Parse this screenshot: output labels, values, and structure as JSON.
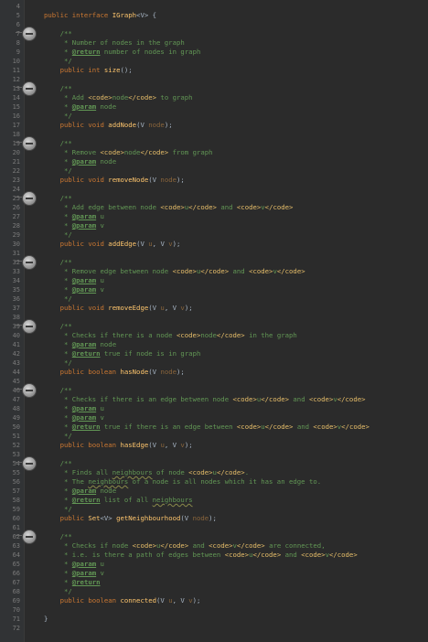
{
  "editor": {
    "lines": [
      {
        "n": "4",
        "segs": []
      },
      {
        "n": "5",
        "segs": [
          [
            "kw",
            "public interface "
          ],
          [
            "cls",
            "IGraph"
          ],
          [
            "",
            "<V> {"
          ]
        ]
      },
      {
        "n": "6",
        "segs": []
      },
      {
        "n": "7",
        "segs": [
          [
            "cm",
            "    /**"
          ]
        ]
      },
      {
        "n": "8",
        "segs": [
          [
            "cm",
            "     * Number of nodes in the graph"
          ]
        ]
      },
      {
        "n": "9",
        "segs": [
          [
            "cm",
            "     * "
          ],
          [
            "ann",
            "@return"
          ],
          [
            "cm",
            " number of nodes in graph"
          ]
        ]
      },
      {
        "n": "10",
        "segs": [
          [
            "cm",
            "     */"
          ]
        ]
      },
      {
        "n": "11",
        "segs": [
          [
            "kw",
            "    public int "
          ],
          [
            "mn",
            "size"
          ],
          [
            "",
            "();"
          ]
        ]
      },
      {
        "n": "12",
        "segs": []
      },
      {
        "n": "13",
        "segs": [
          [
            "cm",
            "    /**"
          ]
        ]
      },
      {
        "n": "14",
        "segs": [
          [
            "cm",
            "     * Add "
          ],
          [
            "tg",
            "<code>"
          ],
          [
            "cm",
            "node"
          ],
          [
            "tg",
            "</code>"
          ],
          [
            "cm",
            " to graph"
          ]
        ]
      },
      {
        "n": "15",
        "segs": [
          [
            "cm",
            "     * "
          ],
          [
            "ann",
            "@param"
          ],
          [
            "cm",
            " node"
          ]
        ]
      },
      {
        "n": "16",
        "segs": [
          [
            "cm",
            "     */"
          ]
        ]
      },
      {
        "n": "17",
        "segs": [
          [
            "kw",
            "    public void "
          ],
          [
            "mn",
            "addNode"
          ],
          [
            "",
            "(V "
          ],
          [
            "pn",
            "node"
          ],
          [
            "",
            ");"
          ]
        ]
      },
      {
        "n": "18",
        "segs": []
      },
      {
        "n": "19",
        "segs": [
          [
            "cm",
            "    /**"
          ]
        ]
      },
      {
        "n": "20",
        "segs": [
          [
            "cm",
            "     * Remove "
          ],
          [
            "tg",
            "<code>"
          ],
          [
            "cm",
            "node"
          ],
          [
            "tg",
            "</code>"
          ],
          [
            "cm",
            " from graph"
          ]
        ]
      },
      {
        "n": "21",
        "segs": [
          [
            "cm",
            "     * "
          ],
          [
            "ann",
            "@param"
          ],
          [
            "cm",
            " node"
          ]
        ]
      },
      {
        "n": "22",
        "segs": [
          [
            "cm",
            "     */"
          ]
        ]
      },
      {
        "n": "23",
        "segs": [
          [
            "kw",
            "    public void "
          ],
          [
            "mn",
            "removeNode"
          ],
          [
            "",
            "(V "
          ],
          [
            "pn",
            "node"
          ],
          [
            "",
            ");"
          ]
        ]
      },
      {
        "n": "24",
        "segs": []
      },
      {
        "n": "25",
        "segs": [
          [
            "cm",
            "    /**"
          ]
        ]
      },
      {
        "n": "26",
        "segs": [
          [
            "cm",
            "     * Add edge between node "
          ],
          [
            "tg",
            "<code>"
          ],
          [
            "cm",
            "u"
          ],
          [
            "tg",
            "</code>"
          ],
          [
            "cm",
            " and "
          ],
          [
            "tg",
            "<code>"
          ],
          [
            "cm",
            "v"
          ],
          [
            "tg",
            "</code>"
          ]
        ]
      },
      {
        "n": "27",
        "segs": [
          [
            "cm",
            "     * "
          ],
          [
            "ann",
            "@param"
          ],
          [
            "cm",
            " u"
          ]
        ]
      },
      {
        "n": "28",
        "segs": [
          [
            "cm",
            "     * "
          ],
          [
            "ann",
            "@param"
          ],
          [
            "cm",
            " v"
          ]
        ]
      },
      {
        "n": "29",
        "segs": [
          [
            "cm",
            "     */"
          ]
        ]
      },
      {
        "n": "30",
        "segs": [
          [
            "kw",
            "    public void "
          ],
          [
            "mn",
            "addEdge"
          ],
          [
            "",
            "(V "
          ],
          [
            "pn",
            "u"
          ],
          [
            "",
            ", V "
          ],
          [
            "pn",
            "v"
          ],
          [
            "",
            ");"
          ]
        ]
      },
      {
        "n": "31",
        "segs": []
      },
      {
        "n": "32",
        "segs": [
          [
            "cm",
            "    /**"
          ]
        ]
      },
      {
        "n": "33",
        "segs": [
          [
            "cm",
            "     * Remove edge between node "
          ],
          [
            "tg",
            "<code>"
          ],
          [
            "cm",
            "u"
          ],
          [
            "tg",
            "</code>"
          ],
          [
            "cm",
            " and "
          ],
          [
            "tg",
            "<code>"
          ],
          [
            "cm",
            "v"
          ],
          [
            "tg",
            "</code>"
          ]
        ]
      },
      {
        "n": "34",
        "segs": [
          [
            "cm",
            "     * "
          ],
          [
            "ann",
            "@param"
          ],
          [
            "cm",
            " u"
          ]
        ]
      },
      {
        "n": "35",
        "segs": [
          [
            "cm",
            "     * "
          ],
          [
            "ann",
            "@param"
          ],
          [
            "cm",
            " v"
          ]
        ]
      },
      {
        "n": "36",
        "segs": [
          [
            "cm",
            "     */"
          ]
        ]
      },
      {
        "n": "37",
        "segs": [
          [
            "kw",
            "    public void "
          ],
          [
            "mn",
            "removeEdge"
          ],
          [
            "",
            "(V "
          ],
          [
            "pn",
            "u"
          ],
          [
            "",
            ", V "
          ],
          [
            "pn",
            "v"
          ],
          [
            "",
            ");"
          ]
        ]
      },
      {
        "n": "38",
        "segs": []
      },
      {
        "n": "39",
        "segs": [
          [
            "cm",
            "    /**"
          ]
        ]
      },
      {
        "n": "40",
        "segs": [
          [
            "cm",
            "     * Checks if there is a node "
          ],
          [
            "tg",
            "<code>"
          ],
          [
            "cm",
            "node"
          ],
          [
            "tg",
            "</code>"
          ],
          [
            "cm",
            " in the graph"
          ]
        ]
      },
      {
        "n": "41",
        "segs": [
          [
            "cm",
            "     * "
          ],
          [
            "ann",
            "@param"
          ],
          [
            "cm",
            " node"
          ]
        ]
      },
      {
        "n": "42",
        "segs": [
          [
            "cm",
            "     * "
          ],
          [
            "ann",
            "@return"
          ],
          [
            "cm",
            " true if node is in graph"
          ]
        ]
      },
      {
        "n": "43",
        "segs": [
          [
            "cm",
            "     */"
          ]
        ]
      },
      {
        "n": "44",
        "segs": [
          [
            "kw",
            "    public boolean "
          ],
          [
            "mn",
            "hasNode"
          ],
          [
            "",
            "(V "
          ],
          [
            "pn",
            "node"
          ],
          [
            "",
            ");"
          ]
        ]
      },
      {
        "n": "45",
        "segs": []
      },
      {
        "n": "46",
        "segs": [
          [
            "cm",
            "    /**"
          ]
        ]
      },
      {
        "n": "47",
        "segs": [
          [
            "cm",
            "     * Checks if there is an edge between node "
          ],
          [
            "tg",
            "<code>"
          ],
          [
            "cm",
            "u"
          ],
          [
            "tg",
            "</code>"
          ],
          [
            "cm",
            " and "
          ],
          [
            "tg",
            "<code>"
          ],
          [
            "cm",
            "v"
          ],
          [
            "tg",
            "</code>"
          ]
        ]
      },
      {
        "n": "48",
        "segs": [
          [
            "cm",
            "     * "
          ],
          [
            "ann",
            "@param"
          ],
          [
            "cm",
            " u"
          ]
        ]
      },
      {
        "n": "49",
        "segs": [
          [
            "cm",
            "     * "
          ],
          [
            "ann",
            "@param"
          ],
          [
            "cm",
            " v"
          ]
        ]
      },
      {
        "n": "50",
        "segs": [
          [
            "cm",
            "     * "
          ],
          [
            "ann",
            "@return"
          ],
          [
            "cm",
            " true if there is an edge between "
          ],
          [
            "tg",
            "<code>"
          ],
          [
            "cm",
            "u"
          ],
          [
            "tg",
            "</code>"
          ],
          [
            "cm",
            " and "
          ],
          [
            "tg",
            "<code>"
          ],
          [
            "cm",
            "v"
          ],
          [
            "tg",
            "</code>"
          ]
        ]
      },
      {
        "n": "51",
        "segs": [
          [
            "cm",
            "     */"
          ]
        ]
      },
      {
        "n": "52",
        "segs": [
          [
            "kw",
            "    public boolean "
          ],
          [
            "mn",
            "hasEdge"
          ],
          [
            "",
            "(V "
          ],
          [
            "pn",
            "u"
          ],
          [
            "",
            ", V "
          ],
          [
            "pn",
            "v"
          ],
          [
            "",
            ");"
          ]
        ]
      },
      {
        "n": "53",
        "segs": []
      },
      {
        "n": "54",
        "segs": [
          [
            "cm",
            "    /**"
          ]
        ]
      },
      {
        "n": "55",
        "segs": [
          [
            "cm",
            "     * Finds all "
          ],
          [
            "cm squig",
            "neighbours"
          ],
          [
            "cm",
            " of node "
          ],
          [
            "tg",
            "<code>"
          ],
          [
            "cm",
            "u"
          ],
          [
            "tg",
            "</code>"
          ],
          [
            "cm",
            "."
          ]
        ]
      },
      {
        "n": "56",
        "segs": [
          [
            "cm",
            "     * The "
          ],
          [
            "cm squig",
            "neighbours"
          ],
          [
            "cm",
            " of a node is all nodes which it has an edge to."
          ]
        ]
      },
      {
        "n": "57",
        "segs": [
          [
            "cm",
            "     * "
          ],
          [
            "ann",
            "@param"
          ],
          [
            "cm",
            " node"
          ]
        ]
      },
      {
        "n": "58",
        "segs": [
          [
            "cm",
            "     * "
          ],
          [
            "ann",
            "@return"
          ],
          [
            "cm",
            " list of all "
          ],
          [
            "cm squig",
            "neighbours"
          ]
        ]
      },
      {
        "n": "59",
        "segs": [
          [
            "cm",
            "     */"
          ]
        ]
      },
      {
        "n": "60",
        "segs": [
          [
            "kw",
            "    public "
          ],
          [
            "cls",
            "Set"
          ],
          [
            "",
            "<V> "
          ],
          [
            "mn",
            "getNeighbourhood"
          ],
          [
            "",
            "(V "
          ],
          [
            "pn",
            "node"
          ],
          [
            "",
            ");"
          ]
        ]
      },
      {
        "n": "61",
        "segs": []
      },
      {
        "n": "62",
        "segs": [
          [
            "cm",
            "    /**"
          ]
        ]
      },
      {
        "n": "63",
        "segs": [
          [
            "cm",
            "     * Checks if node "
          ],
          [
            "tg",
            "<code>"
          ],
          [
            "cm",
            "u"
          ],
          [
            "tg",
            "</code>"
          ],
          [
            "cm",
            " and "
          ],
          [
            "tg",
            "<code>"
          ],
          [
            "cm",
            "v"
          ],
          [
            "tg",
            "</code>"
          ],
          [
            "cm",
            " are connected,"
          ]
        ]
      },
      {
        "n": "64",
        "segs": [
          [
            "cm",
            "     * i.e. is there a path of edges between "
          ],
          [
            "tg",
            "<code>"
          ],
          [
            "cm",
            "u"
          ],
          [
            "tg",
            "</code>"
          ],
          [
            "cm",
            " and "
          ],
          [
            "tg",
            "<code>"
          ],
          [
            "cm",
            "v"
          ],
          [
            "tg",
            "</code>"
          ]
        ]
      },
      {
        "n": "65",
        "segs": [
          [
            "cm",
            "     * "
          ],
          [
            "ann",
            "@param"
          ],
          [
            "cm",
            " u"
          ]
        ]
      },
      {
        "n": "66",
        "segs": [
          [
            "cm",
            "     * "
          ],
          [
            "ann",
            "@param"
          ],
          [
            "cm",
            " v"
          ]
        ]
      },
      {
        "n": "67",
        "segs": [
          [
            "cm",
            "     * "
          ],
          [
            "ann",
            "@return"
          ]
        ]
      },
      {
        "n": "68",
        "segs": [
          [
            "cm",
            "     */"
          ]
        ]
      },
      {
        "n": "69",
        "segs": [
          [
            "kw",
            "    public boolean "
          ],
          [
            "mn",
            "connected"
          ],
          [
            "",
            "(V "
          ],
          [
            "pn",
            "u"
          ],
          [
            "",
            ", V "
          ],
          [
            "pn",
            "v"
          ],
          [
            "",
            ");"
          ]
        ]
      },
      {
        "n": "70",
        "segs": []
      },
      {
        "n": "71",
        "segs": [
          [
            "",
            "}"
          ]
        ]
      },
      {
        "n": "72",
        "segs": []
      }
    ],
    "fold_markers": [
      "7",
      "13",
      "19",
      "25",
      "32",
      "39",
      "46",
      "54",
      "62"
    ]
  }
}
